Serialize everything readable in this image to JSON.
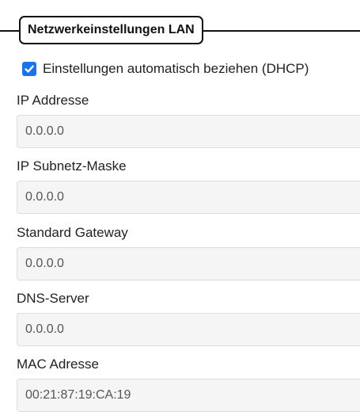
{
  "section": {
    "legend": "Netzwerkeinstellungen LAN"
  },
  "dhcp": {
    "checked": true,
    "label": "Einstellungen automatisch beziehen (DHCP)"
  },
  "fields": [
    {
      "label": "IP Addresse",
      "value": "0.0.0.0"
    },
    {
      "label": "IP Subnetz-Maske",
      "value": "0.0.0.0"
    },
    {
      "label": "Standard Gateway",
      "value": "0.0.0.0"
    },
    {
      "label": "DNS-Server",
      "value": "0.0.0.0"
    },
    {
      "label": "MAC Adresse",
      "value": "00:21:87:19:CA:19"
    }
  ],
  "colors": {
    "checkbox_accent": "#1a73e8",
    "field_background": "#f5f5f5",
    "border": "#111111"
  }
}
